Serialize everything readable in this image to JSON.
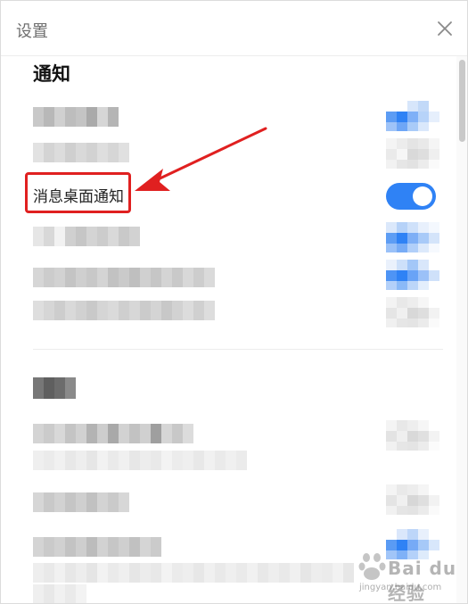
{
  "dialog": {
    "title": "设置",
    "close_icon": "close-icon"
  },
  "notifications": {
    "section_title": "通知",
    "highlighted_item": {
      "label": "消息桌面通知",
      "toggle_on": true
    }
  },
  "colors": {
    "accent": "#2f82f5",
    "highlight": "#e02020",
    "arrow": "#e02020"
  },
  "watermark": {
    "brand": "Bai du 经验",
    "sub": "jingyan.baidu.com"
  }
}
